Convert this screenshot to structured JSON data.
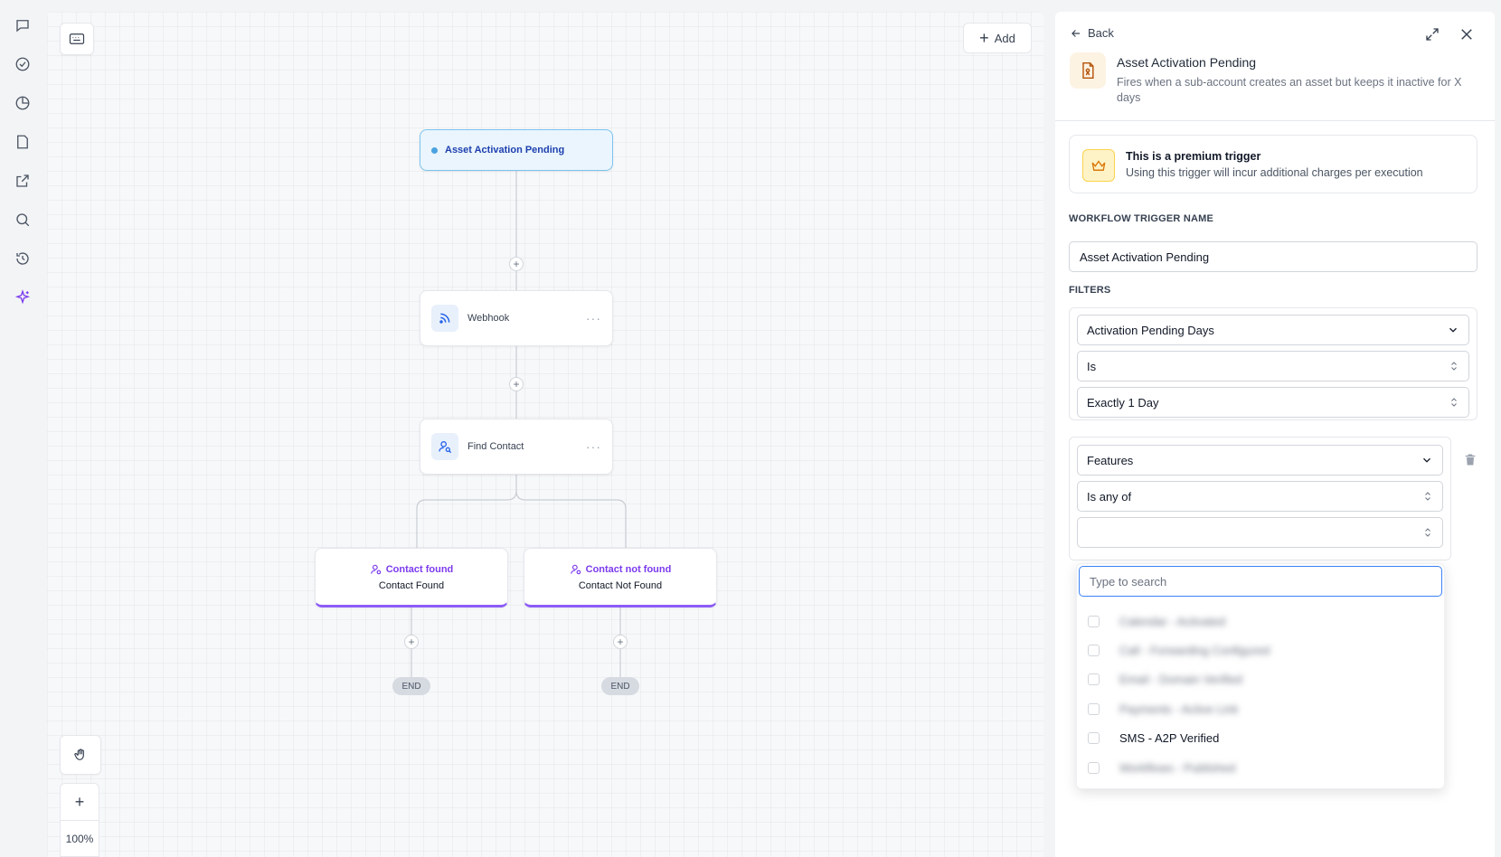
{
  "rail": {
    "icons": [
      "chat-icon",
      "check-circle-icon",
      "pie-chart-icon",
      "document-icon",
      "external-link-icon",
      "search-icon",
      "history-icon",
      "sparkle-icon"
    ],
    "accent": "#7c3aed"
  },
  "canvas": {
    "add_label": "Add",
    "zoom_level": "100%",
    "trigger_label": "Asset Activation Pending",
    "nodes": [
      {
        "label": "Webhook",
        "icon": "rss-icon"
      },
      {
        "label": "Find Contact",
        "icon": "user-search-icon"
      }
    ],
    "branches": [
      {
        "title": "Contact found",
        "subtitle": "Contact Found",
        "end": "END"
      },
      {
        "title": "Contact not found",
        "subtitle": "Contact Not Found",
        "end": "END"
      }
    ],
    "node_menu": "···",
    "plus": "+"
  },
  "panel": {
    "back_label": "Back",
    "title": "Asset Activation Pending",
    "description": "Fires when a sub-account creates an asset but keeps it inactive for X days",
    "premium": {
      "title": "This is a premium trigger",
      "description": "Using this trigger will incur additional charges per execution"
    },
    "trigger_name_label": "WORKFLOW TRIGGER NAME",
    "trigger_name_value": "Asset Activation Pending",
    "filters_label": "FILTERS",
    "filter1": {
      "field": "Activation Pending Days",
      "operator": "Is",
      "value": "Exactly 1 Day"
    },
    "filter2": {
      "field": "Features",
      "operator": "Is any of",
      "value": ""
    },
    "dropdown": {
      "search_placeholder": "Type to search",
      "options": [
        {
          "label": "Calendar - Activated",
          "blurred": true
        },
        {
          "label": "Call - Forwarding Configured",
          "blurred": true
        },
        {
          "label": "Email - Domain Verified",
          "blurred": true
        },
        {
          "label": "Payments - Active Link",
          "blurred": true
        },
        {
          "label": "SMS - A2P Verified",
          "blurred": false
        },
        {
          "label": "Workflows - Published",
          "blurred": true
        }
      ]
    },
    "colors": {
      "trigger_border": "#7cc4ef",
      "branch_accent": "#8b5cf6",
      "focus_border": "#3b82f6",
      "premium_bg": "#fef3c7"
    }
  }
}
